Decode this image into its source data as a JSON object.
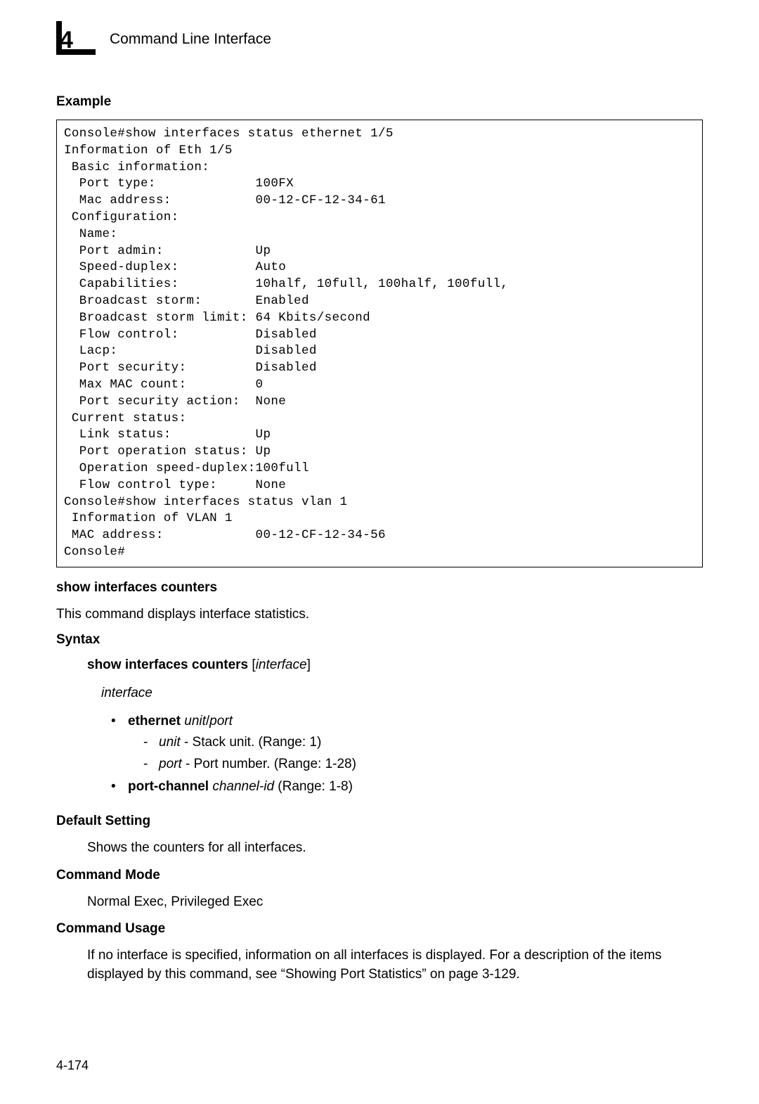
{
  "header": {
    "chapter_number": "4",
    "title": "Command Line Interface"
  },
  "example": {
    "heading": "Example",
    "code": "Console#show interfaces status ethernet 1/5\nInformation of Eth 1/5\n Basic information:\n  Port type:             100FX\n  Mac address:           00-12-CF-12-34-61\n Configuration:\n  Name:\n  Port admin:            Up\n  Speed-duplex:          Auto\n  Capabilities:          10half, 10full, 100half, 100full,\n  Broadcast storm:       Enabled\n  Broadcast storm limit: 64 Kbits/second\n  Flow control:          Disabled\n  Lacp:                  Disabled\n  Port security:         Disabled\n  Max MAC count:         0\n  Port security action:  None\n Current status:\n  Link status:           Up\n  Port operation status: Up\n  Operation speed-duplex:100full\n  Flow control type:     None\nConsole#show interfaces status vlan 1\n Information of VLAN 1\n MAC address:            00-12-CF-12-34-56\nConsole#"
  },
  "section": {
    "title": "show interfaces counters",
    "description": "This command displays interface statistics."
  },
  "syntax": {
    "heading": "Syntax",
    "cmd_bold": "show interfaces counters",
    "cmd_open": " [",
    "cmd_italic": "interface",
    "cmd_close": "]",
    "interface_label": "interface",
    "ethernet_bold": "ethernet",
    "ethernet_italic": " unit",
    "ethernet_slash": "/",
    "ethernet_port_italic": "port",
    "unit_italic": "unit",
    "unit_desc": " - Stack unit. (Range: 1)",
    "port_italic": "port",
    "port_desc": " - Port number. (Range: 1-28)",
    "portchannel_bold": "port-channel",
    "portchannel_italic": " channel-id",
    "portchannel_rest": " (Range: 1-8)"
  },
  "default_setting": {
    "heading": "Default Setting",
    "text": "Shows the counters for all interfaces."
  },
  "command_mode": {
    "heading": "Command Mode",
    "text": "Normal Exec, Privileged Exec"
  },
  "command_usage": {
    "heading": "Command Usage",
    "text": "If no interface is specified, information on all interfaces is displayed. For a description of the items displayed by this command, see “Showing Port Statistics” on page 3-129."
  },
  "page_number": "4-174"
}
